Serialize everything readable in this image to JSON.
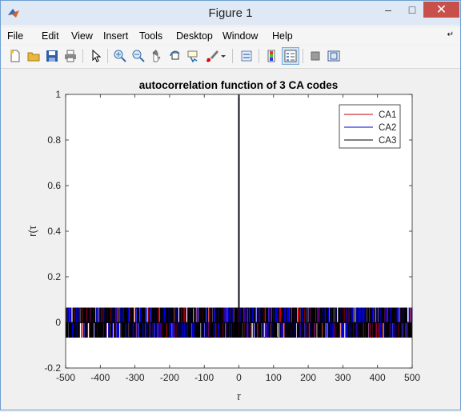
{
  "window": {
    "title": "Figure 1",
    "minimize_glyph": "–",
    "maximize_glyph": "□",
    "close_glyph": "✕"
  },
  "menu": {
    "items": [
      "File",
      "Edit",
      "View",
      "Insert",
      "Tools",
      "Desktop",
      "Window",
      "Help"
    ],
    "overflow_glyph": "↵"
  },
  "toolbar": {
    "icons": [
      "new-figure-icon",
      "open-file-icon",
      "save-icon",
      "print-icon",
      "pointer-icon",
      "zoom-in-icon",
      "zoom-out-icon",
      "pan-icon",
      "rotate-3d-icon",
      "data-cursor-icon",
      "brush-icon",
      "link-plot-icon",
      "colorbar-icon",
      "legend-icon",
      "hide-plot-tools-icon",
      "show-plot-tools-icon"
    ],
    "selected": "legend-icon"
  },
  "chart_data": {
    "type": "line",
    "title": "autocorrelation function of 3 CA codes",
    "xlabel": "τ",
    "ylabel": "r(τ",
    "xlim": [
      -500,
      500
    ],
    "ylim": [
      -0.2,
      1
    ],
    "xticks": [
      -500,
      -400,
      -300,
      -200,
      -100,
      0,
      100,
      200,
      300,
      400,
      500
    ],
    "yticks": [
      -0.2,
      0,
      0.2,
      0.4,
      0.6,
      0.8,
      1
    ],
    "ytick_labels": [
      "-0.2",
      "0",
      "0.2",
      "0.4",
      "0.6",
      "0.8",
      "1"
    ],
    "grid": false,
    "legend_position": "top-right",
    "series": [
      {
        "name": "CA1",
        "color": "#c00000",
        "peak_at": 0,
        "peak_value": 1,
        "sidelobe_values": [
          -0.065,
          -0.001,
          0.063
        ]
      },
      {
        "name": "CA2",
        "color": "#0000d0",
        "peak_at": 0,
        "peak_value": 1,
        "sidelobe_values": [
          -0.065,
          -0.001,
          0.063
        ]
      },
      {
        "name": "CA3",
        "color": "#000000",
        "peak_at": 0,
        "peak_value": 1,
        "sidelobe_values": [
          -0.065,
          -0.001,
          0.063
        ]
      }
    ]
  }
}
